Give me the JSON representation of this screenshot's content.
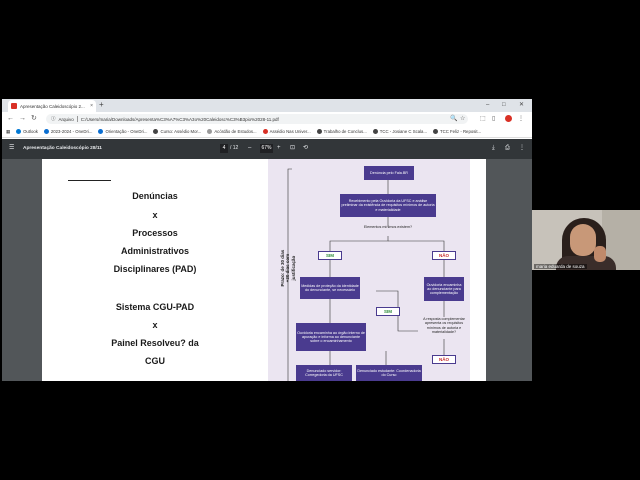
{
  "browser": {
    "tab_title": "Apresentação Caleidoscópio 2...",
    "tab_close": "×",
    "new_tab": "+",
    "window_controls": {
      "minimize": "–",
      "maximize": "□",
      "close": "✕"
    },
    "address_label": "Arquivo",
    "url": "C:/Users/maria/Downloads/Apresenta%C3%A7%C3%A3o%20Caleidosc%C3%B3pio%2028-11.pdf"
  },
  "bookmarks": [
    {
      "label": "Outlook",
      "color": "#0078d4"
    },
    {
      "label": "2023-2024 - OneDri...",
      "color": "#0a6ed1"
    },
    {
      "label": "Orientação - OneDri...",
      "color": "#0a6ed1"
    },
    {
      "label": "Curso: Assédio Mor...",
      "color": "#444444"
    },
    {
      "label": "Acórdão de Estudos...",
      "color": "#999999"
    },
    {
      "label": "Assédio Nas Univer...",
      "color": "#d93025"
    },
    {
      "label": "Trabalho de Conclus...",
      "color": "#444444"
    },
    {
      "label": "TCC - Josiane C Scala...",
      "color": "#444444"
    },
    {
      "label": "TCC Feliz - Reposit...",
      "color": "#444444"
    }
  ],
  "pdf_toolbar": {
    "menu_icon": "☰",
    "title": "Apresentação Caleidoscópio 28/11",
    "current_page": "4",
    "page_total": "/ 12",
    "zoom": "67%",
    "zoom_out": "–",
    "zoom_in": "+"
  },
  "slide": {
    "left_lines": [
      "Denúncias",
      "x",
      "Processos",
      "Administrativos",
      "Disciplinares (PAD)",
      "Sistema CGU-PAD",
      "x",
      "Painel Resolveu? da",
      "CGU"
    ],
    "vertical_label": "Prazo: de 30 dias +30 dias com justificação",
    "flow": {
      "b1": "Denúncia pelo Fala.BR",
      "b2": "Recebimento pela Ouvidoria da UFSC e análise preliminar da existência de requisitos mínimos de autoria e materialidade",
      "q1": "Elementos mínimos existem?",
      "sim1": "SIM",
      "nao1": "NÃO",
      "b3": "Medidas de proteção da identidade do denunciante, se necessário",
      "b4": "Ouvidoria encaminha ao denunciante para complementação",
      "sim2": "SIM",
      "q2": "A resposta complementar apresenta os requisitos mínimos de autoria e materialidade?",
      "b5": "Ouvidoria encaminha ao órgão interno de apuração e informa ao denunciante sobre o encaminhamento",
      "nao2": "NÃO",
      "b6": "Denunciado servidor: Corregedoria da UFSC",
      "b7": "Denunciado estudante: Coordenadoria do Curso"
    }
  },
  "video": {
    "participant_name": "maria eduarda de souza"
  },
  "colors": {
    "flow_box": "#4a3b8f",
    "flow_bg": "#ebe5f1",
    "sim": "#2e8b3a",
    "nao": "#c62828",
    "pdf_toolbar": "#323639"
  }
}
